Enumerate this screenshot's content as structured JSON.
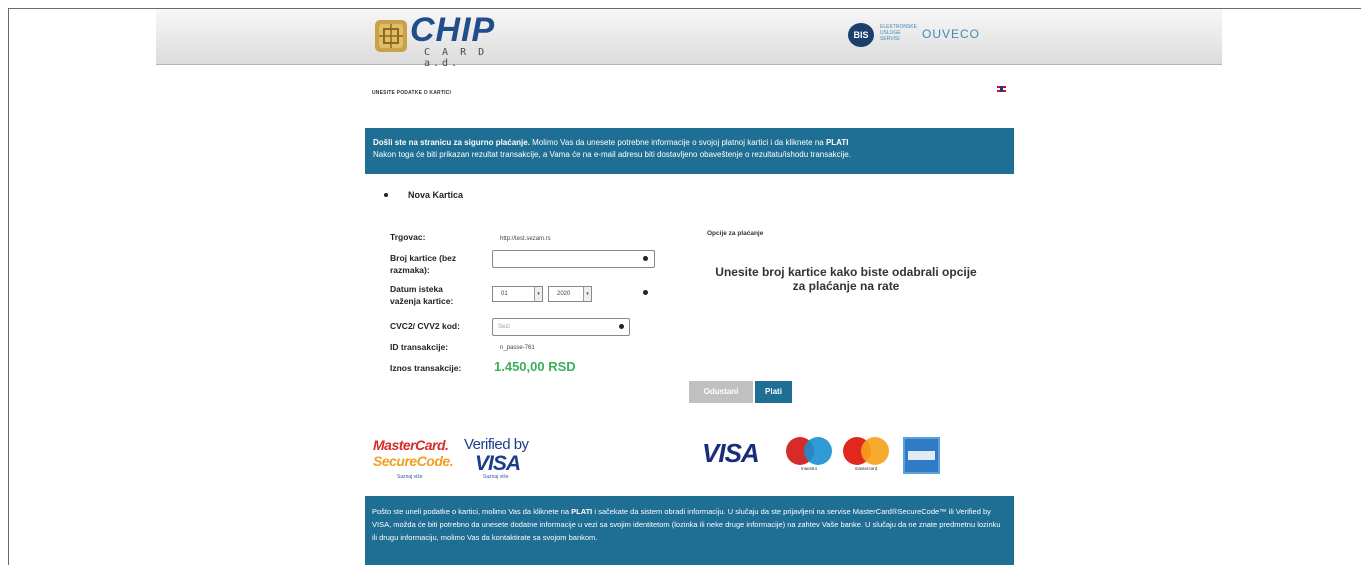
{
  "header": {
    "logo_main": "CHIP",
    "logo_sub": "C A R D a.d.",
    "partner_small": "ELEKTRONSKE USLUGE SERVISI",
    "partner_word": "OUVECO",
    "partner_circle": "BIS"
  },
  "page": {
    "heading": "UNESITE PODATKE O KARTICI",
    "language_flag": "flag-uk-icon"
  },
  "info": {
    "bold": "Došli ste na stranicu za sigurno plaćanje.",
    "line1": " Molimo Vas da unesete potrebne informacije o svojoj platnoj kartici i da kliknete na ",
    "plati": "PLATI",
    "line2": "Nakon toga će biti prikazan rezultat transakcije, a Vama će na e-mail adresu biti dostavljeno obaveštenje o rezultatu/ishodu transakcije."
  },
  "form": {
    "new_card": "Nova Kartica",
    "merchant_label": "Trgovac:",
    "merchant_value": "http://test.sezam.rs",
    "card_number_label": "Broj kartice (bez razmaka):",
    "card_number_value": "",
    "expiry_label": "Datum isteka važenja kartice:",
    "expiry_month": "01",
    "expiry_year": "2020",
    "cvc_label": "CVC2/ CVV2 kod:",
    "cvc_placeholder": "Sezi",
    "transaction_id_label": "ID transakcije:",
    "transaction_id_value": "n_passe-761",
    "amount_label": "Iznos transakcije:",
    "amount_value": "1.450,00 RSD"
  },
  "options": {
    "title": "Opcije za plaćanje",
    "message_line1": "Unesite broj kartice kako biste odabrali opcije",
    "message_line2": "za plaćanje na rate"
  },
  "buttons": {
    "cancel": "Odustani",
    "pay": "Plati"
  },
  "logos": {
    "mc_secure_line1": "MasterCard.",
    "mc_secure_line2": "SecureCode.",
    "mc_secure_caption": "Saznaj više",
    "vbv_line1": "Verified by",
    "vbv_line2": "VISA",
    "vbv_caption": "Saznaj više",
    "visa": "VISA",
    "maestro_caption": "maestro",
    "mastercard_caption": "mastercard",
    "colors": {
      "info_blue": "#1f6e94",
      "amount_green": "#3cb05b",
      "mc_red": "#d62b2b",
      "mc_orange": "#f0a020",
      "visa_blue": "#1a2d7a"
    }
  },
  "footer": {
    "text_a": "Pošto ste uneli podatke o kartici, molimo Vas da kliknete na ",
    "plati": "PLATI",
    "text_b": " i sačekate da sistem obradi informaciju. U slučaju da ste prijavljeni na servise MasterCard®SecureCode™ ili Verified by VISA, možda će biti potrebno da unesete dodatne informacije u vezi sa svojim identitetom (lozinka ili neke druge informacije) na zahtev Vaše banke. U slučaju da ne znate predmetnu lozinku ili drugu informaciju, molimo Vas da kontaktirate sa svojom bankom."
  }
}
